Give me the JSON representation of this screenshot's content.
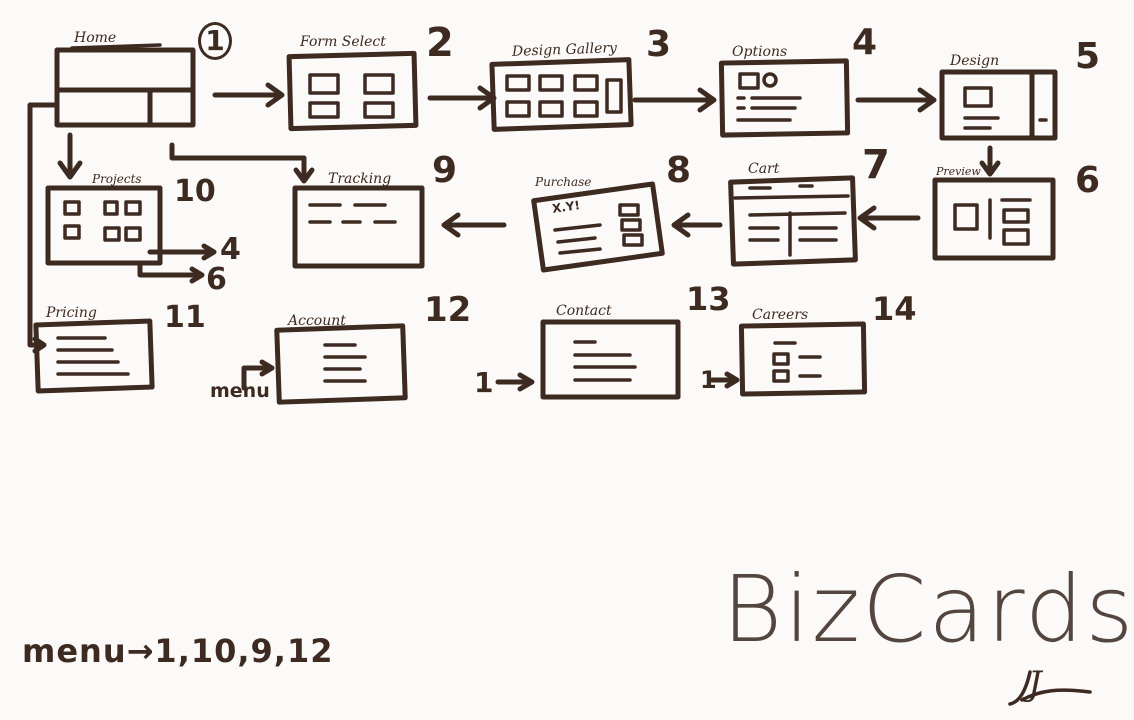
{
  "screens": [
    {
      "id": "home",
      "label": "Home",
      "number": "1"
    },
    {
      "id": "form-select",
      "label": "Form Select",
      "number": "2"
    },
    {
      "id": "design-gallery",
      "label": "Design Gallery",
      "number": "3"
    },
    {
      "id": "options",
      "label": "Options",
      "number": "4"
    },
    {
      "id": "design",
      "label": "Design",
      "number": "5"
    },
    {
      "id": "preview",
      "label": "Preview",
      "number": "6"
    },
    {
      "id": "cart",
      "label": "Cart",
      "number": "7"
    },
    {
      "id": "purchase",
      "label": "Purchase",
      "number": "8"
    },
    {
      "id": "tracking",
      "label": "Tracking",
      "number": "9"
    },
    {
      "id": "projects",
      "label": "Projects",
      "number": "10"
    },
    {
      "id": "pricing",
      "label": "Pricing",
      "number": "11"
    },
    {
      "id": "account",
      "label": "Account",
      "number": "12"
    },
    {
      "id": "contact",
      "label": "Contact",
      "number": "13"
    },
    {
      "id": "careers",
      "label": "Careers",
      "number": "14"
    }
  ],
  "annotations": {
    "projects_to_options": "4",
    "projects_to_preview": "6",
    "account_entry": "menu",
    "contact_entry": "1",
    "careers_entry": "1",
    "purchase_sketch_text": "X.Y!"
  },
  "footer": {
    "menu_note": "menu→1,10,9,12",
    "brand": "BizCards",
    "signature": "J"
  },
  "colors": {
    "ink": "#3d2a20",
    "paper": "#fbfaf8",
    "brand": "#54463e"
  }
}
